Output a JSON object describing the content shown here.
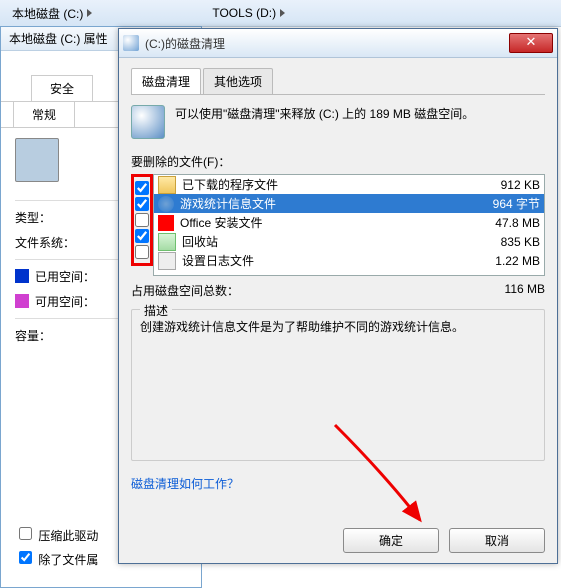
{
  "bgbar": {
    "crumb1": "本地磁盘 (C:)",
    "crumb2": "TOOLS (D:)"
  },
  "prop": {
    "title": "本地磁盘 (C:) 属性",
    "tab_security": "安全",
    "tab_general": "常规",
    "label_type": "类型：",
    "label_fs": "文件系统：",
    "label_used": "已用空间：",
    "label_free": "可用空间：",
    "label_capacity": "容量：",
    "cb_compress": "压缩此驱动",
    "cb_index": "除了文件属"
  },
  "dc": {
    "title": "(C:)的磁盘清理",
    "tab_cleanup": "磁盘清理",
    "tab_other": "其他选项",
    "info": "可以使用\"磁盘清理\"来释放  (C:) 上的 189 MB 磁盘空间。",
    "section_files": "要删除的文件(F)：",
    "files": [
      {
        "name": "已下载的程序文件",
        "size": "912 KB",
        "checked": true,
        "icon": "folder"
      },
      {
        "name": "游戏统计信息文件",
        "size": "964 字节",
        "checked": true,
        "icon": "stats",
        "selected": true
      },
      {
        "name": "Office 安装文件",
        "size": "47.8 MB",
        "checked": false,
        "icon": "office"
      },
      {
        "name": "回收站",
        "size": "835 KB",
        "checked": true,
        "icon": "recycle"
      },
      {
        "name": "设置日志文件",
        "size": "1.22 MB",
        "checked": false,
        "icon": "log"
      }
    ],
    "total_label": "占用磁盘空间总数：",
    "total_value": "116 MB",
    "group_legend": "描述",
    "description": "创建游戏统计信息文件是为了帮助维护不同的游戏统计信息。",
    "link": "磁盘清理如何工作？",
    "btn_ok": "确定",
    "btn_cancel": "取消"
  }
}
